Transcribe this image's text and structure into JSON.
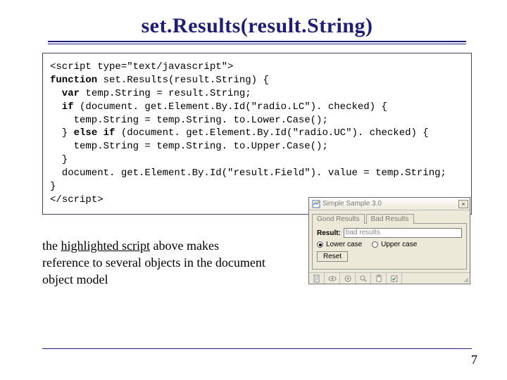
{
  "title": "set.Results(result.String)",
  "code": {
    "l1": "<script type=\"text/javascript\">",
    "l2a": "function",
    "l2b": " set.Results(result.String) {",
    "l3a": "  var",
    "l3b": " temp.String = result.String;",
    "l4a": "  if",
    "l4b": " (document. get.Element.By.Id(\"radio.LC\"). checked) {",
    "l5": "    temp.String = temp.String. to.Lower.Case();",
    "l6a": "  } ",
    "l6b": "else if",
    "l6c": " (document. get.Element.By.Id(\"radio.UC\"). checked) {",
    "l7": "    temp.String = temp.String. to.Upper.Case();",
    "l8": "  }",
    "l9": "  document. get.Element.By.Id(\"result.Field\"). value = temp.String;",
    "l10": "}",
    "l11_open": "</",
    "l11_close": "script>"
  },
  "caption": {
    "pre": "the ",
    "highlight": "highlighted script",
    "post": " above makes reference to several objects in the document object model"
  },
  "page_number": "7",
  "demo": {
    "window_title": "Simple Sample 3.0",
    "close_glyph": "×",
    "tabs": [
      "Good Results",
      "Bad Results"
    ],
    "result_label": "Result:",
    "result_value": "bad results",
    "radio_lower": "Lower case",
    "radio_upper": "Upper case",
    "reset_label": "Reset"
  }
}
